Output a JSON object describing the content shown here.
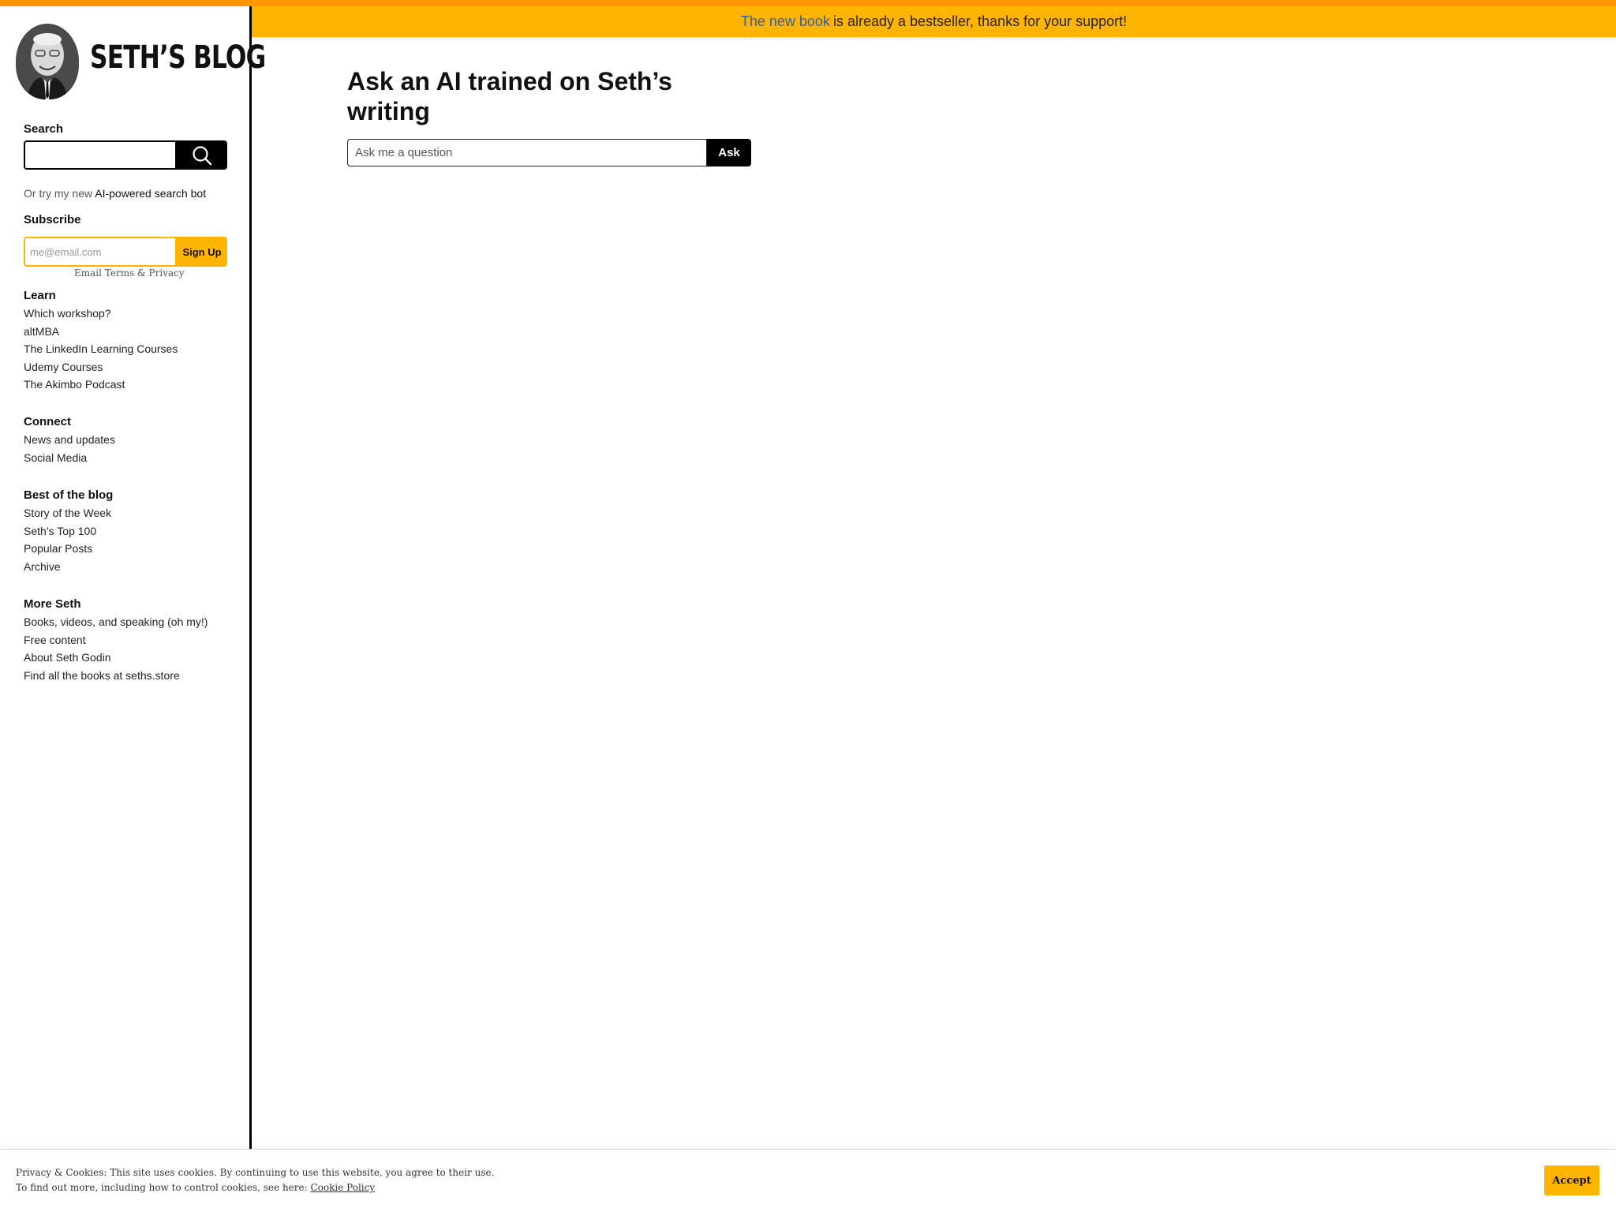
{
  "banner": {
    "link_text": "The new book",
    "text": "is already a bestseller, thanks for your support!"
  },
  "sidebar": {
    "brand_title": "SETH’S BLOG",
    "search": {
      "label": "Search",
      "icon": "search-icon"
    },
    "ai_note": {
      "prefix": "Or try my new",
      "link": "AI-powered search bot"
    },
    "subscribe": {
      "label": "Subscribe",
      "placeholder": "me@email.com",
      "button": "Sign Up",
      "terms": "Email Terms & Privacy"
    },
    "sections": [
      {
        "title": "Learn",
        "items": [
          "Which workshop?",
          "altMBA",
          "The LinkedIn Learning Courses",
          "Udemy Courses",
          "The Akimbo Podcast"
        ]
      },
      {
        "title": "Connect",
        "items": [
          "News and updates",
          "Social Media"
        ]
      },
      {
        "title": "Best of the blog",
        "items": [
          "Story of the Week",
          "Seth’s Top 100",
          "Popular Posts",
          "Archive"
        ]
      },
      {
        "title": "More Seth",
        "items": [
          "Books, videos, and speaking (oh my!)",
          "Free content",
          "About Seth Godin",
          "Find all the books at seths.store"
        ]
      }
    ]
  },
  "main": {
    "title": "Ask an AI trained on Seth’s writing",
    "ask_placeholder": "Ask me a question",
    "ask_button": "Ask"
  },
  "cookie": {
    "line1": "Privacy & Cookies: This site uses cookies. By continuing to use this website, you agree to their use.",
    "line2_prefix": "To find out more, including how to control cookies, see here:",
    "link": "Cookie Policy",
    "accept": "Accept"
  },
  "colors": {
    "accent": "#ffb400",
    "top_stripe": "#ff9500",
    "link_blue": "#2f5fa8"
  }
}
